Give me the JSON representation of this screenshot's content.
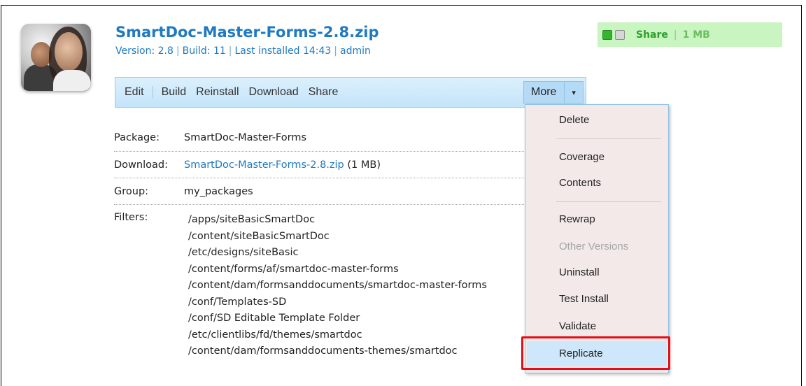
{
  "package": {
    "title": "SmartDoc-Master-Forms-2.8.zip",
    "meta": {
      "version": "Version: 2.8",
      "build": "Build: 11",
      "installed": "Last installed 14:43",
      "user": "admin",
      "separator": "|"
    },
    "share_status": {
      "label": "Share",
      "separator": "|",
      "size": "1 MB"
    }
  },
  "toolbar": {
    "edit": "Edit",
    "build": "Build",
    "reinstall": "Reinstall",
    "download": "Download",
    "share": "Share",
    "more": "More",
    "more_caret": "▾"
  },
  "details": {
    "package_label": "Package:",
    "package_value": "SmartDoc-Master-Forms",
    "download_label": "Download:",
    "download_link": "SmartDoc-Master-Forms-2.8.zip",
    "download_size": " (1 MB)",
    "group_label": "Group:",
    "group_value": "my_packages",
    "filters_label": "Filters:",
    "filters": [
      "/apps/siteBasicSmartDoc",
      "/content/siteBasicSmartDoc",
      "/etc/designs/siteBasic",
      "/content/forms/af/smartdoc-master-forms",
      "/content/dam/formsanddocuments/smartdoc-master-forms",
      "/conf/Templates-SD",
      "/conf/SD Editable Template Folder",
      "/etc/clientlibs/fd/themes/smartdoc",
      "/content/dam/formsanddocuments-themes/smartdoc"
    ]
  },
  "more_menu": {
    "delete": "Delete",
    "coverage": "Coverage",
    "contents": "Contents",
    "rewrap": "Rewrap",
    "other_versions": "Other Versions",
    "uninstall": "Uninstall",
    "test_install": "Test Install",
    "validate": "Validate",
    "replicate": "Replicate"
  },
  "colors": {
    "title_blue": "#1f7ac2",
    "toolbar_bg": "#c4e4f9",
    "share_green_bg": "#c8f5c0",
    "highlight_red": "#e60d16"
  }
}
